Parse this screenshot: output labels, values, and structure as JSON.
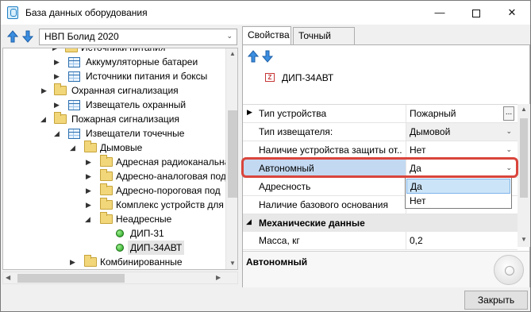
{
  "window": {
    "title": "База данных оборудования"
  },
  "left": {
    "manufacturer": "НВП Болид 2020",
    "tree": [
      {
        "label": "Источники питания",
        "icon": "folder"
      },
      {
        "label": "Аккумуляторные батареи",
        "icon": "table"
      },
      {
        "label": "Источники питания и боксы",
        "icon": "table"
      },
      {
        "label": "Охранная сигнализация",
        "icon": "folder"
      },
      {
        "label": "Извещатель охранный",
        "icon": "table"
      },
      {
        "label": "Пожарная сигнализация",
        "icon": "folder"
      },
      {
        "label": "Извещатели точечные",
        "icon": "table"
      },
      {
        "label": "Дымовые",
        "icon": "folder"
      },
      {
        "label": "Адресная радиоканальная",
        "icon": "folder"
      },
      {
        "label": "Адресно-аналоговая под",
        "icon": "folder"
      },
      {
        "label": "Адресно-пороговая под",
        "icon": "folder"
      },
      {
        "label": "Комплекс устройств для",
        "icon": "folder"
      },
      {
        "label": "Неадресные",
        "icon": "folder"
      },
      {
        "label": "ДИП-31",
        "icon": "device"
      },
      {
        "label": "ДИП-34АВТ",
        "icon": "device"
      },
      {
        "label": "Комбинированные",
        "icon": "folder"
      }
    ]
  },
  "right": {
    "tabs": [
      "Свойства",
      "Точный вид"
    ],
    "device_name": "ДИП-34АВТ",
    "device_badge": "Z",
    "properties": [
      {
        "name": "Тип устройства",
        "value": "Пожарный"
      },
      {
        "name": "Тип извещателя:",
        "value": "Дымовой"
      },
      {
        "name": "Наличие устройства защиты от...",
        "value": "Нет"
      },
      {
        "name": "Автономный",
        "value": "Да"
      },
      {
        "name": "Адресность",
        "value": ""
      },
      {
        "name": "Наличие базового основания",
        "value": ""
      }
    ],
    "category": "Механические данные",
    "mass": {
      "name": "Масса, кг",
      "value": "0,2"
    },
    "dropdown_options": [
      "Да",
      "Нет"
    ],
    "description_title": "Автономный"
  },
  "footer": {
    "close_label": "Закрыть"
  },
  "colors": {
    "highlight": "#d9453c",
    "selection": "#cce4f7"
  }
}
